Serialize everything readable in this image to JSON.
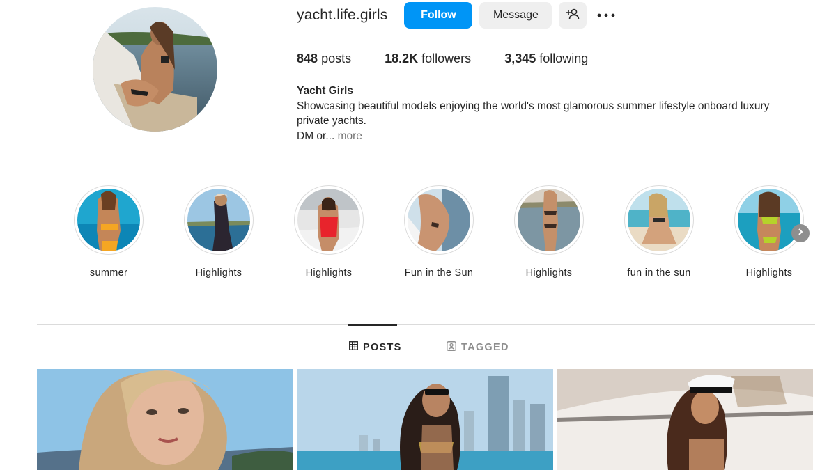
{
  "profile": {
    "username": "yacht.life.girls",
    "follow_label": "Follow",
    "message_label": "Message",
    "add_user_icon": "add-user-icon",
    "more_icon": "more-horizontal-icon"
  },
  "stats": {
    "posts_count": "848",
    "posts_label": "posts",
    "followers_count": "18.2K",
    "followers_label": "followers",
    "following_count": "3,345",
    "following_label": "following"
  },
  "bio": {
    "name": "Yacht Girls",
    "line1": "Showcasing beautiful models enjoying the world's most glamorous summer lifestyle onboard luxury",
    "line2": "private yachts.",
    "line3": "DM or...",
    "more_label": "more"
  },
  "highlights": [
    {
      "label": "summer"
    },
    {
      "label": "Highlights"
    },
    {
      "label": "Highlights"
    },
    {
      "label": "Fun in the Sun"
    },
    {
      "label": "Highlights"
    },
    {
      "label": "fun in the sun"
    },
    {
      "label": "Highlights"
    }
  ],
  "tabs": {
    "posts_label": "POSTS",
    "tagged_label": "TAGGED",
    "posts_icon": "grid-icon",
    "tagged_icon": "tagged-user-icon"
  },
  "colors": {
    "accent": "#0095f6",
    "button_bg": "#efefef",
    "text": "#262626",
    "muted": "#737373",
    "border": "#dbdbdb"
  }
}
